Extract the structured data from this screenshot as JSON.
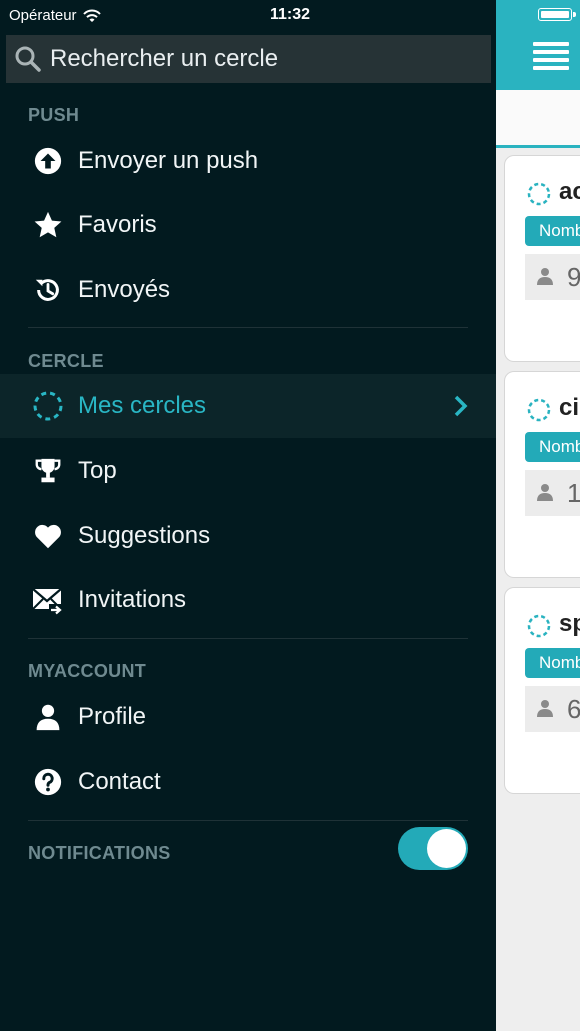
{
  "status_bar": {
    "carrier": "Opérateur",
    "time": "11:32"
  },
  "search": {
    "placeholder": "Rechercher un cercle"
  },
  "sections": {
    "push": "PUSH",
    "cercle": "CERCLE",
    "myaccount": "MYACCOUNT",
    "notifications": "NOTIFICATIONS"
  },
  "menu": {
    "send_push": "Envoyer un push",
    "favoris": "Favoris",
    "envoyes": "Envoyés",
    "mes_cercles": "Mes cercles",
    "top": "Top",
    "suggestions": "Suggestions",
    "invitations": "Invitations",
    "profile": "Profile",
    "contact": "Contact"
  },
  "notifications_enabled": true,
  "colors": {
    "accent": "#2ab3c0",
    "menu_bg": "#021a1f",
    "section": "#6f8a90"
  },
  "cards": [
    {
      "name": "ac",
      "badge": "Nomb",
      "count": "9"
    },
    {
      "name": "ci",
      "badge": "Nomb",
      "count": "1"
    },
    {
      "name": "sp",
      "badge": "Nomb",
      "count": "6"
    }
  ]
}
